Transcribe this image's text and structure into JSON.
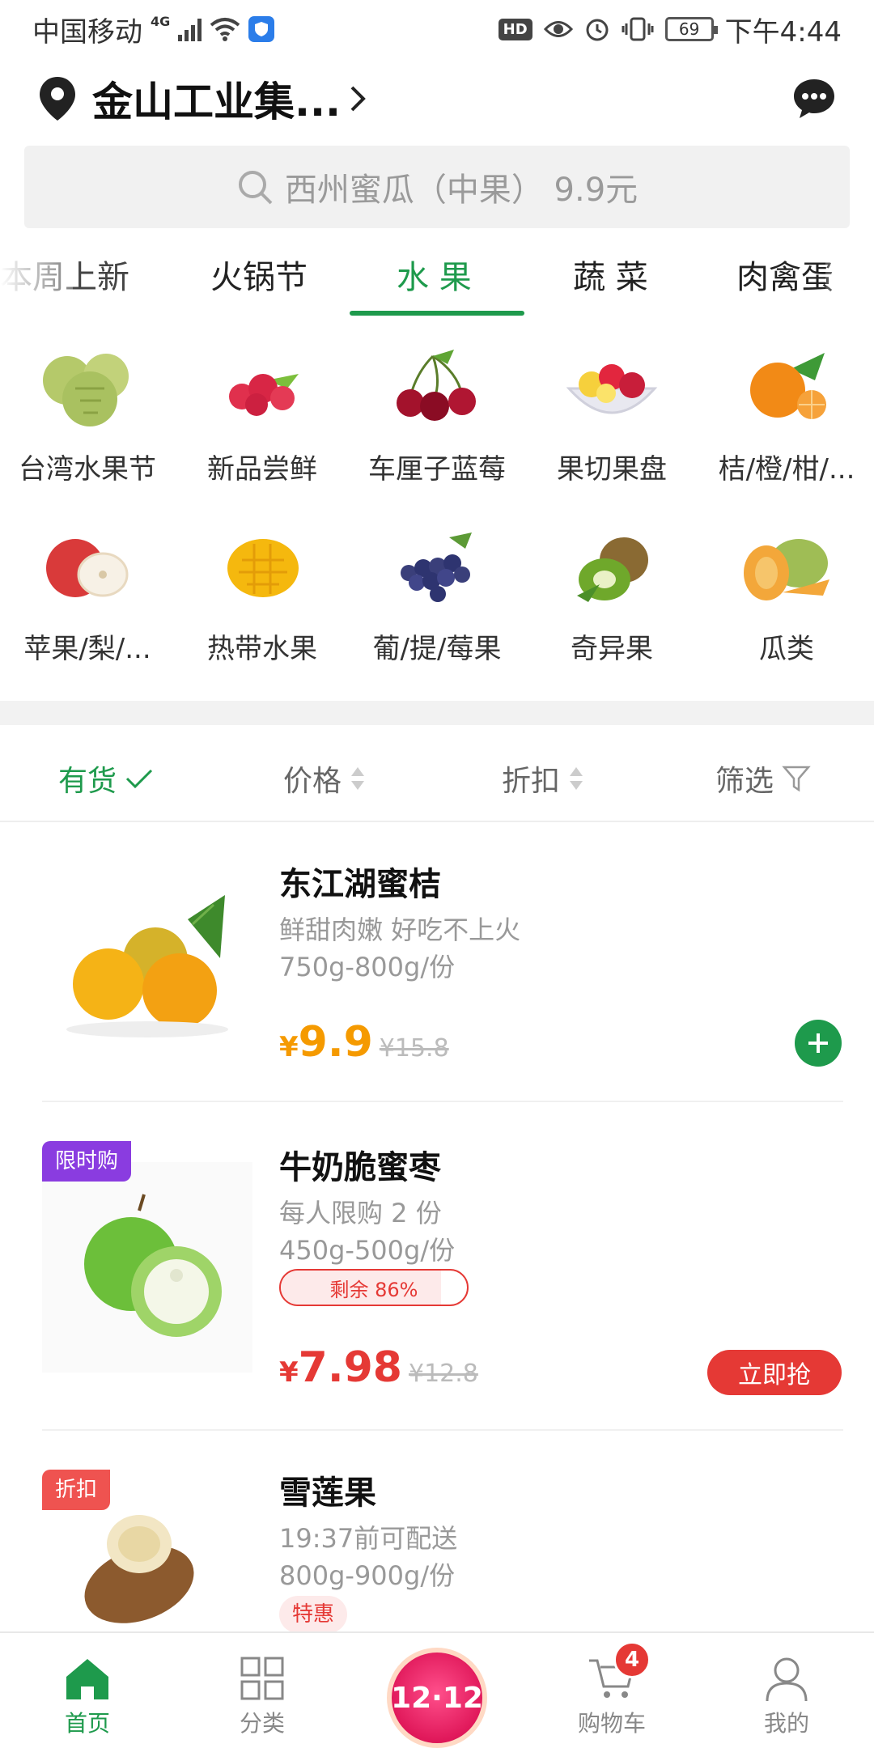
{
  "status_bar": {
    "carrier": "中国移动",
    "network": "4G",
    "hd": "HD",
    "battery": "69",
    "time": "下午4:44"
  },
  "header": {
    "location": "金山工业集...",
    "chevron_icon": "chevron-right-icon",
    "message_icon": "chat-bubble-icon"
  },
  "search": {
    "placeholder": "西州蜜瓜（中果） 9.9元"
  },
  "tabs": [
    {
      "label": "本周上新"
    },
    {
      "label": "火锅节"
    },
    {
      "label": "水 果",
      "active": true
    },
    {
      "label": "蔬 菜"
    },
    {
      "label": "肉禽蛋"
    }
  ],
  "categories": [
    {
      "label": "台湾水果节"
    },
    {
      "label": "新品尝鲜"
    },
    {
      "label": "车厘子蓝莓"
    },
    {
      "label": "果切果盘"
    },
    {
      "label": "桔/橙/柑/..."
    },
    {
      "label": "苹果/梨/..."
    },
    {
      "label": "热带水果"
    },
    {
      "label": "葡/提/莓果"
    },
    {
      "label": "奇异果"
    },
    {
      "label": "瓜类"
    }
  ],
  "filters": {
    "in_stock": "有货",
    "price": "价格",
    "discount": "折扣",
    "filter": "筛选"
  },
  "products": [
    {
      "name": "东江湖蜜桔",
      "subtitle": "鲜甜肉嫩 好吃不上火",
      "weight": "750g-800g/份",
      "currency": "¥",
      "price": "9.9",
      "old_price": "¥15.8"
    },
    {
      "badge": "限时购",
      "name": "牛奶脆蜜枣",
      "subtitle": "每人限购 2 份",
      "weight": "450g-500g/份",
      "stock_label": "剩余 86%",
      "stock_percent": 86,
      "currency": "¥",
      "price": "7.98",
      "old_price": "¥12.8",
      "buy_label": "立即抢"
    },
    {
      "badge": "折扣",
      "name": "雪莲果",
      "subtitle": "19:37前可配送",
      "weight": "800g-900g/份",
      "tag": "特惠"
    }
  ],
  "bottom_nav": {
    "home": "首页",
    "category": "分类",
    "promo": "12·12",
    "cart": "购物车",
    "cart_count": "4",
    "mine": "我的"
  },
  "colors": {
    "brand_green": "#1e9a4c",
    "price_orange": "#f59a00",
    "price_red": "#e53935",
    "badge_purple": "#8a3ce0",
    "badge_red": "#ef5350"
  }
}
